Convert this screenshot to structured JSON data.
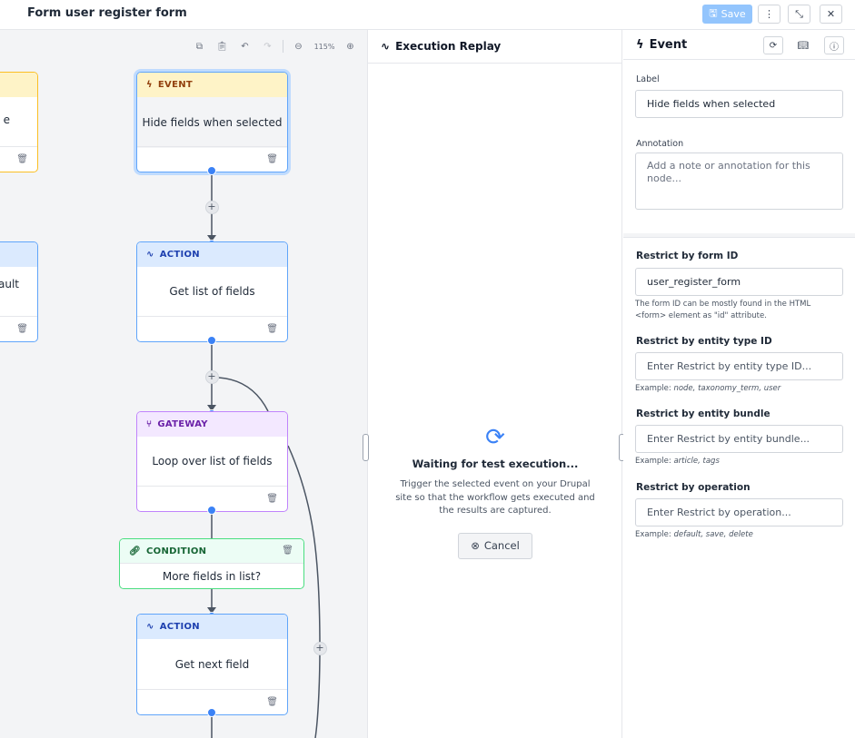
{
  "header": {
    "title": "Form user register form",
    "save_label": "Save"
  },
  "canvas": {
    "zoom": "115%",
    "nodes": {
      "event": {
        "type": "EVENT",
        "label": "Hide fields when selected"
      },
      "action1": {
        "type": "ACTION",
        "label": "Get list of fields"
      },
      "gateway": {
        "type": "GATEWAY",
        "label": "Loop over list of fields"
      },
      "condition": {
        "type": "CONDITION",
        "label": "More fields in list?"
      },
      "action2": {
        "type": "ACTION",
        "label": "Get next field"
      },
      "partial_top": {
        "label_fragment": "e"
      },
      "partial_mid": {
        "label_fragment": "ault"
      }
    }
  },
  "replay": {
    "title": "Execution Replay",
    "waiting": "Waiting for test execution...",
    "description": "Trigger the selected event on your Drupal site so that the workflow gets executed and the results are captured.",
    "cancel_label": "Cancel"
  },
  "props": {
    "title": "Event",
    "label_caption": "Label",
    "label_value": "Hide fields when selected",
    "annotation_caption": "Annotation",
    "annotation_placeholder": "Add a note or annotation for this node...",
    "form_id_caption": "Restrict by form ID",
    "form_id_value": "user_register_form",
    "form_id_help": "The form ID can be mostly found in the HTML <form> element as \"id\" attribute.",
    "entity_type_caption": "Restrict by entity type ID",
    "entity_type_placeholder": "Enter Restrict by entity type ID...",
    "entity_type_help_prefix": "Example: ",
    "entity_type_help_values": "node, taxonomy_term, user",
    "bundle_caption": "Restrict by entity bundle",
    "bundle_placeholder": "Enter Restrict by entity bundle...",
    "bundle_help_prefix": "Example: ",
    "bundle_help_values": "article, tags",
    "operation_caption": "Restrict by operation",
    "operation_placeholder": "Enter Restrict by operation...",
    "operation_help_prefix": "Example: ",
    "operation_help_values": "default, save, delete"
  },
  "icons": [
    "save-icon",
    "more-icon",
    "collapse-icon",
    "close-icon",
    "copy-icon",
    "paste-icon",
    "undo-icon",
    "redo-icon",
    "zoom-out-icon",
    "zoom-in-icon",
    "pulse-icon",
    "lightning-icon",
    "trash-icon",
    "branch-icon",
    "link-icon",
    "refresh-icon",
    "book-icon",
    "info-icon",
    "cancel-icon",
    "spinner-icon"
  ],
  "colors": {
    "accent": "#3b82f6",
    "event_header": "#fef3c7",
    "action_header": "#dbeafe",
    "gateway_header": "#f3e8ff",
    "condition_header": "#ecfdf5"
  }
}
